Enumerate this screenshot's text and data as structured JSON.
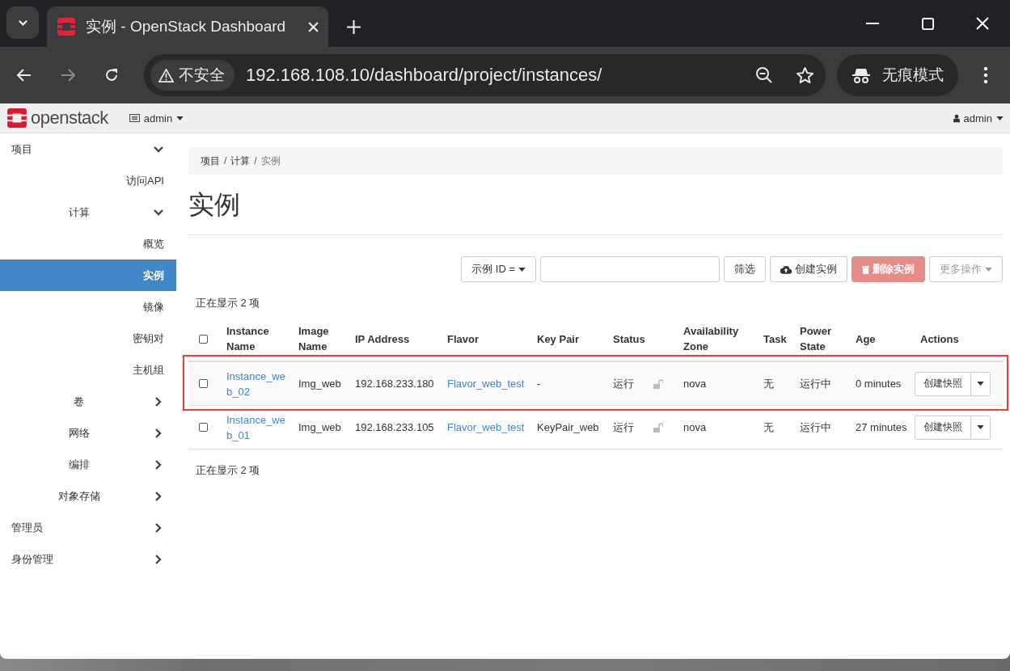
{
  "browser": {
    "tab_title": "实例 - OpenStack Dashboard",
    "security_label": "不安全",
    "url": "192.168.108.10/dashboard/project/instances/",
    "incognito_label": "无痕模式"
  },
  "header": {
    "logo_text": "openstack",
    "project": "admin",
    "user": "admin"
  },
  "sidebar": {
    "items": [
      {
        "kind": "group",
        "label": "项目",
        "expanded": true,
        "selected": false,
        "children": [
          {
            "kind": "leaf",
            "label": "访问API",
            "selected": false
          },
          {
            "kind": "group",
            "label": "计算",
            "expanded": true,
            "selected": false,
            "children": [
              {
                "kind": "leaf",
                "label": "概览",
                "selected": false
              },
              {
                "kind": "leaf",
                "label": "实例",
                "selected": true
              },
              {
                "kind": "leaf",
                "label": "镜像",
                "selected": false
              },
              {
                "kind": "leaf",
                "label": "密钥对",
                "selected": false
              },
              {
                "kind": "leaf",
                "label": "主机组",
                "selected": false
              }
            ]
          },
          {
            "kind": "group",
            "label": "卷",
            "expanded": false,
            "selected": false
          },
          {
            "kind": "group",
            "label": "网络",
            "expanded": false,
            "selected": false
          },
          {
            "kind": "group",
            "label": "编排",
            "expanded": false,
            "selected": false
          },
          {
            "kind": "group",
            "label": "对象存储",
            "expanded": false,
            "selected": false
          }
        ]
      },
      {
        "kind": "group",
        "label": "管理员",
        "expanded": false,
        "selected": false
      },
      {
        "kind": "group",
        "label": "身份管理",
        "expanded": false,
        "selected": false
      }
    ]
  },
  "breadcrumb": {
    "separator": "/",
    "items": [
      "项目",
      "计算",
      "实例"
    ]
  },
  "page_title": "实例",
  "toolbar": {
    "filter_select": "示例 ID =",
    "buttons": [
      {
        "kind": "filter",
        "label": "筛选",
        "disabled": false
      },
      {
        "kind": "create",
        "label": "创建实例",
        "disabled": false
      },
      {
        "kind": "delete",
        "label": "删除实例",
        "disabled": true
      },
      {
        "kind": "more",
        "label": "更多操作",
        "disabled": true
      }
    ]
  },
  "count_top": "正在显示 2 项",
  "table": {
    "columns": [
      "Instance Name",
      "Image Name",
      "IP Address",
      "Flavor",
      "Key Pair",
      "Status",
      "Availability Zone",
      "Task",
      "Power State",
      "Age",
      "Actions"
    ],
    "header_checked": false,
    "rows": [
      {
        "checked": false,
        "highlighted": true,
        "name": "Instance_web_02",
        "image": "Img_web",
        "ip": "192.168.233.180",
        "flavor": "Flavor_web_test",
        "key_pair": "-",
        "status": "运行",
        "locked": false,
        "zone": "nova",
        "task": "无",
        "power_state": "运行中",
        "age": "0 minutes",
        "action": "创建快照"
      },
      {
        "checked": false,
        "highlighted": false,
        "name": "Instance_web_01",
        "image": "Img_web",
        "ip": "192.168.233.105",
        "flavor": "Flavor_web_test",
        "key_pair": "KeyPair_web",
        "status": "运行",
        "locked": false,
        "zone": "nova",
        "task": "无",
        "power_state": "运行中",
        "age": "27 minutes",
        "action": "创建快照"
      }
    ]
  },
  "count_bottom": "正在显示 2 项"
}
